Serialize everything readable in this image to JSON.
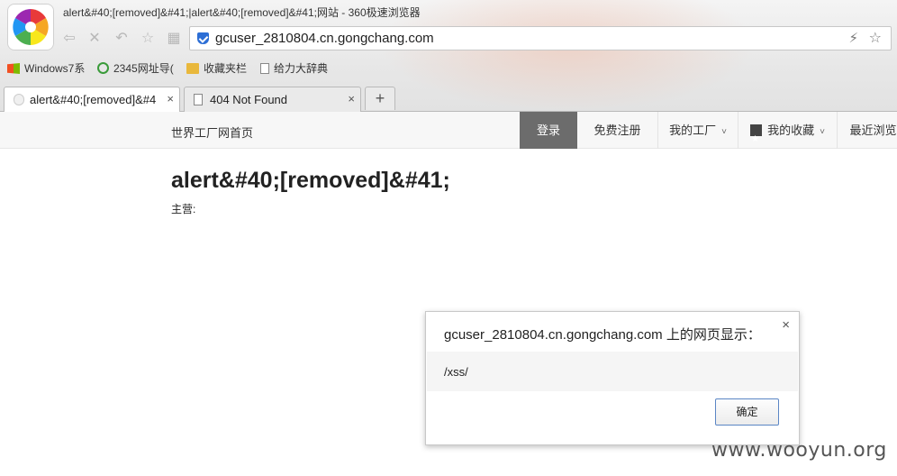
{
  "window": {
    "title": "alert&#40;[removed]&#41;|alert&#40;[removed]&#41;网站 - 360极速浏览器"
  },
  "toolbar": {
    "back_icon": "back-arrow-icon",
    "stop_icon": "close-icon",
    "undo_icon": "undo-icon",
    "home_icon": "star-outline-icon",
    "apps_icon": "grid-icon"
  },
  "address_bar": {
    "url": "gcuser_2810804.cn.gongchang.com",
    "secure_icon": "shield-icon",
    "accelerate_icon": "lightning-icon",
    "favorite_icon": "star-icon"
  },
  "bookmarks": [
    {
      "label": "Windows7系",
      "icon": "windows-icon"
    },
    {
      "label": "2345网址导(",
      "icon": "2345-icon"
    },
    {
      "label": "收藏夹栏",
      "icon": "folder-icon"
    },
    {
      "label": "给力大辞典",
      "icon": "page-icon"
    }
  ],
  "tabs": [
    {
      "label": "alert&#40;[removed]&#4",
      "active": true,
      "close": "×"
    },
    {
      "label": "404 Not Found",
      "active": false,
      "close": "×"
    }
  ],
  "new_tab_label": "+",
  "site_nav": {
    "home": "世界工厂网首页",
    "login": "登录",
    "register": "免费注册",
    "my_factory": "我的工厂",
    "my_favorites": "我的收藏",
    "recent": "最近浏览"
  },
  "page": {
    "title": "alert&#40;[removed]&#41;",
    "main_business_label": "主营:"
  },
  "dialog": {
    "title": "gcuser_2810804.cn.gongchang.com 上的网页显示：",
    "message": "/xss/",
    "ok_label": "确定",
    "close": "×"
  },
  "watermark": "www.wooyun.org",
  "colors": {
    "login_bg": "#6c6c6c",
    "dialog_button_border": "#5b86c5",
    "address_shield": "#2c6ed5"
  }
}
